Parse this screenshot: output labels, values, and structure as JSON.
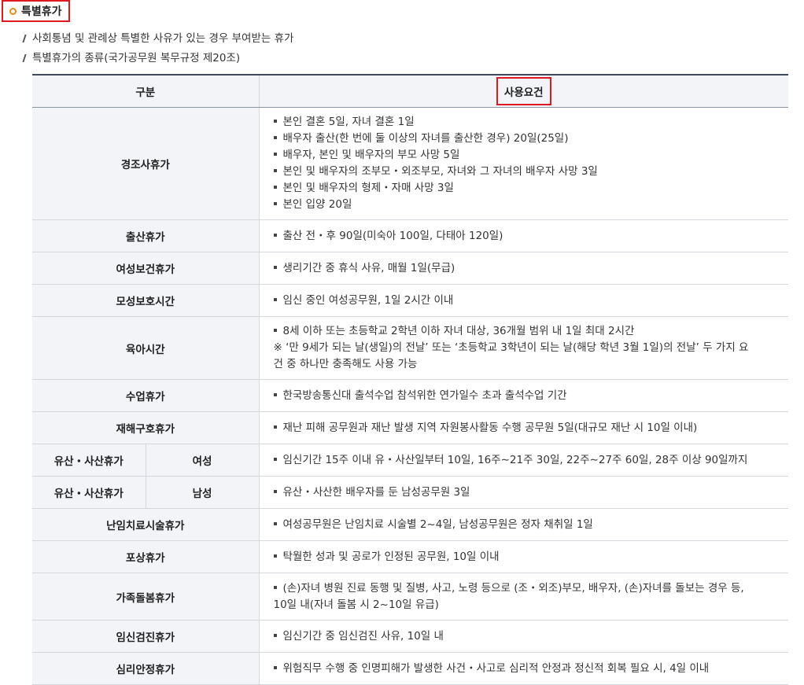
{
  "section": {
    "title": "특별휴가",
    "bullets": [
      "사회통념 및 관례상 특별한 사유가 있는 경우 부여받는 휴가",
      "특별휴가의 종류(국가공무원 복무규정 제20조)"
    ]
  },
  "table": {
    "headers": {
      "category": "구분",
      "requirement": "사용요건"
    },
    "rows": [
      {
        "category": "경조사휴가",
        "items": [
          "본인 결혼 5일, 자녀 결혼 1일",
          "배우자 출산(한 번에 둘 이상의 자녀를 출산한 경우) 20일(25일)",
          "배우자, 본인 및 배우자의 부모 사망 5일",
          "본인 및 배우자의 조부모・외조부모, 자녀와 그 자녀의 배우자 사망 3일",
          "본인 및 배우자의 형제・자매 사망 3일",
          "본인 입양 20일"
        ]
      },
      {
        "category": "출산휴가",
        "items": [
          "출산 전・후 90일(미숙아 100일, 다태아 120일)"
        ]
      },
      {
        "category": "여성보건휴가",
        "items": [
          "생리기간 중 휴식 사유, 매월 1일(무급)"
        ]
      },
      {
        "category": "모성보호시간",
        "items": [
          "임신 중인 여성공무원, 1일 2시간 이내"
        ]
      },
      {
        "category": "육아시간",
        "items": [
          "8세 이하 또는 초등학교 2학년 이하 자녀 대상, 36개월 범위 내 1일 최대 2시간"
        ],
        "note_lines": [
          "※ ‘만 9세가 되는 날(생일)의 전날’ 또는 ‘초등학교 3학년이 되는 날(해당 학년 3월 1일)의 전날’ 두 가지 요",
          "건 중 하나만 충족해도 사용 가능"
        ]
      },
      {
        "category": "수업휴가",
        "items": [
          "한국방송통신대 출석수업 참석위한 연가일수 초과 출석수업 기간"
        ]
      },
      {
        "category": "재해구호휴가",
        "items": [
          "재난 피해 공무원과 재난 발생 지역 자원봉사활동 수행 공무원 5일(대규모 재난 시 10일 이내)"
        ]
      },
      {
        "category": "유산・사산휴가",
        "sub": "여성",
        "items": [
          "임신기간 15주 이내 유・사산일부터 10일, 16주∼21주 30일, 22주∼27주 60일, 28주 이상 90일까지"
        ]
      },
      {
        "category": "유산・사산휴가",
        "sub": "남성",
        "items": [
          "유산・사산한 배우자를 둔 남성공무원 3일"
        ]
      },
      {
        "category": "난임치료시술휴가",
        "items": [
          "여성공무원은 난임치료 시술별 2~4일, 남성공무원은 정자 채취일 1일"
        ]
      },
      {
        "category": "포상휴가",
        "items": [
          "탁월한 성과 및 공로가 인정된 공무원, 10일 이내"
        ]
      },
      {
        "category": "가족돌봄휴가",
        "items": [
          "(손)자녀 병원 진료 동행 및 질병, 사고, 노령 등으로 (조・외조)부모, 배우자, (손)자녀를 돌보는 경우 등,"
        ],
        "cont_lines": [
          "10일 내(자녀 돌봄 시 2~10일 유급)"
        ]
      },
      {
        "category": "임신검진휴가",
        "items": [
          "임신기간 중 임신검진 사유, 10일 내"
        ]
      },
      {
        "category": "심리안정휴가",
        "items": [
          "위험직무 수행 중 인명피해가 발생한 사건・사고로 심리적 안정과 정신적 회복 필요 시, 4일 이내"
        ]
      }
    ]
  }
}
